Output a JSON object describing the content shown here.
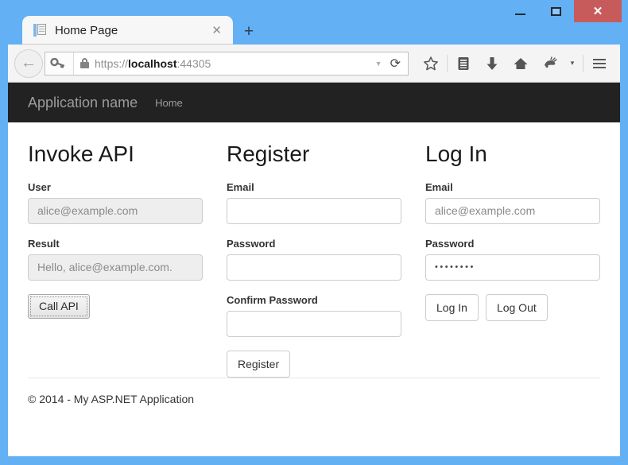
{
  "window": {
    "controls": {
      "minimize": "—",
      "maximize": "□",
      "close": "✕"
    },
    "accent_blue": "#63b0f5",
    "close_red": "#c75b5b"
  },
  "tabs": {
    "active": {
      "title": "Home Page",
      "favicon": "page-icon",
      "close": "✕"
    },
    "new_tab_label": "+"
  },
  "toolbar": {
    "back": "←",
    "identity_icon": "key-icon",
    "lock_icon": "padlock-icon",
    "url_scheme": "https://",
    "url_host": "localhost",
    "url_port": ":44305",
    "url_full": "https://localhost:44305",
    "url_dropdown": "▼",
    "reload": "↻",
    "icons": [
      {
        "name": "bookmark-star-icon",
        "glyph": "☆"
      },
      {
        "name": "reading-list-icon",
        "glyph": "⌸"
      },
      {
        "name": "downloads-icon",
        "glyph": "⬇"
      },
      {
        "name": "home-icon",
        "glyph": "⌂"
      },
      {
        "name": "sync-fox-icon",
        "glyph": "❦"
      }
    ],
    "overflow_caret": "▾",
    "menu_icon": "hamburger-menu-icon"
  },
  "navbar": {
    "brand": "Application name",
    "links": [
      {
        "label": "Home"
      }
    ]
  },
  "columns": [
    {
      "id": "invoke-api",
      "title": "Invoke API",
      "fields": [
        {
          "id": "user",
          "label": "User",
          "value": "alice@example.com",
          "state": "readonly",
          "type": "text"
        },
        {
          "id": "result",
          "label": "Result",
          "value": "Hello, alice@example.com.",
          "state": "readonly",
          "type": "text"
        }
      ],
      "buttons": [
        {
          "id": "call-api",
          "label": "Call API",
          "style": "native"
        }
      ]
    },
    {
      "id": "register",
      "title": "Register",
      "fields": [
        {
          "id": "register-email",
          "label": "Email",
          "value": "",
          "state": "empty",
          "type": "email"
        },
        {
          "id": "register-password",
          "label": "Password",
          "value": "",
          "state": "empty",
          "type": "password"
        },
        {
          "id": "register-confirm-password",
          "label": "Confirm Password",
          "value": "",
          "state": "empty",
          "type": "password"
        }
      ],
      "buttons": [
        {
          "id": "register",
          "label": "Register",
          "style": "default"
        }
      ]
    },
    {
      "id": "log-in",
      "title": "Log In",
      "fields": [
        {
          "id": "login-email",
          "label": "Email",
          "value": "alice@example.com",
          "state": "filled",
          "type": "email"
        },
        {
          "id": "login-password",
          "label": "Password",
          "value": "••••••••",
          "state": "password",
          "type": "password",
          "char_count": 8
        }
      ],
      "buttons": [
        {
          "id": "log-in",
          "label": "Log In",
          "style": "default"
        },
        {
          "id": "log-out",
          "label": "Log Out",
          "style": "default"
        }
      ]
    }
  ],
  "footer": {
    "copyright": "© 2014 - My ASP.NET Application"
  }
}
